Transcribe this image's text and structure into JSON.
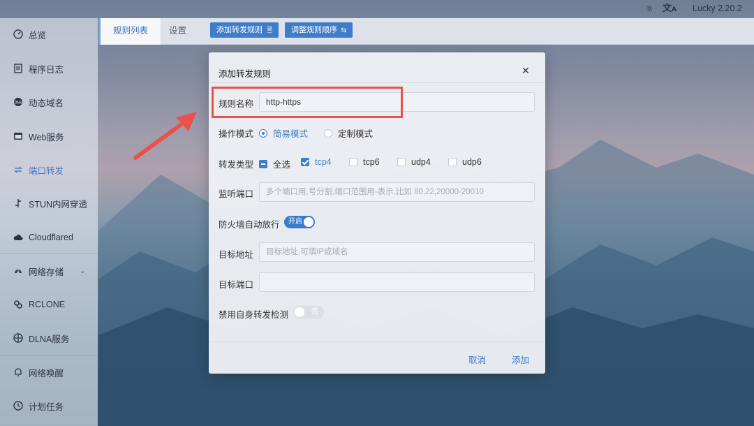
{
  "topbar": {
    "theme_icon": "sun-icon",
    "lang_icon": "translate-icon",
    "version": "Lucky 2.20.2"
  },
  "sidebar": {
    "items": [
      {
        "label": "总览",
        "icon": "dashboard-icon"
      },
      {
        "label": "程序日志",
        "icon": "log-icon"
      },
      {
        "label": "动态域名",
        "icon": "ddns-icon"
      },
      {
        "label": "Web服务",
        "icon": "web-service-icon"
      },
      {
        "label": "端口转发",
        "icon": "port-forward-icon"
      },
      {
        "label": "STUN内网穿透",
        "icon": "stun-icon"
      },
      {
        "label": "Cloudflared",
        "icon": "cloud-icon"
      },
      {
        "label": "网络存储",
        "icon": "storage-icon"
      },
      {
        "label": "RCLONE",
        "icon": "rclone-icon"
      },
      {
        "label": "DLNA服务",
        "icon": "dlna-icon"
      },
      {
        "label": "网络唤醒",
        "icon": "bell-icon"
      },
      {
        "label": "计划任务",
        "icon": "clock-icon"
      }
    ]
  },
  "tabs": {
    "rule_list": "规则列表",
    "settings": "设置",
    "add_rule_btn": "添加转发规则",
    "reorder_btn": "调整规则顺序"
  },
  "dialog": {
    "title": "添加转发规则",
    "name_label": "规则名称",
    "name_value": "http-https",
    "mode_label": "操作模式",
    "mode_simple": "简易模式",
    "mode_custom": "定制模式",
    "type_label": "转发类型",
    "type_all": "全选",
    "type_tcp4": "tcp4",
    "type_tcp6": "tcp6",
    "type_udp4": "udp4",
    "type_udp6": "udp6",
    "listen_label": "监听端口",
    "listen_placeholder": "多个端口用,号分割,端口范围用-表示,比如 80,22,20000-20010",
    "firewall_label": "防火墙自动放行",
    "firewall_switch": "开启",
    "target_addr_label": "目标地址",
    "target_addr_placeholder": "目标地址,可填IP或域名",
    "target_port_label": "目标端口",
    "target_port_value": "",
    "self_check_label": "禁用自身转发检测",
    "self_check_switch": "否",
    "cancel": "取消",
    "add": "添加"
  },
  "colors": {
    "accent": "#3c7ccc",
    "annotation": "#e8524a"
  }
}
